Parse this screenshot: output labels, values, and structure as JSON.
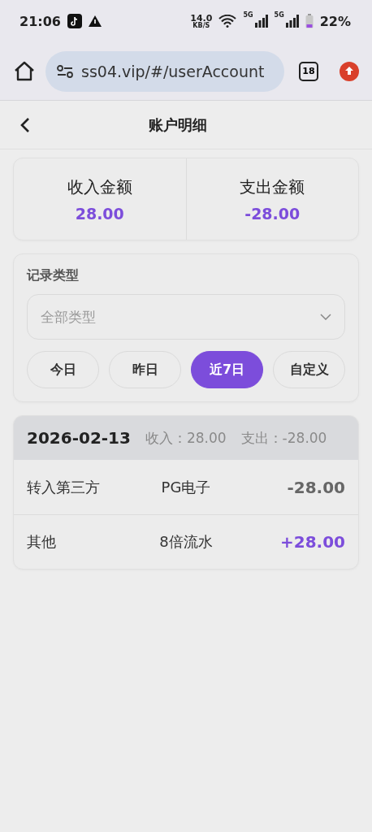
{
  "status_bar": {
    "time": "21:06",
    "net_speed": "14.0",
    "net_unit": "KB/S",
    "sim_labels": [
      "5G",
      "5G"
    ],
    "battery": "22%"
  },
  "browser": {
    "url": "ss04.vip/#/userAccount",
    "tab_count": "18"
  },
  "header": {
    "title": "账户明细"
  },
  "summary": [
    {
      "label": "收入金额",
      "value": "28.00"
    },
    {
      "label": "支出金额",
      "value": "-28.00"
    }
  ],
  "filter": {
    "label": "记录类型",
    "placeholder": "全部类型",
    "ranges": [
      {
        "label": "今日",
        "selected": false
      },
      {
        "label": "昨日",
        "selected": false
      },
      {
        "label": "近7日",
        "selected": true
      },
      {
        "label": "自定义",
        "selected": false
      }
    ]
  },
  "groups": [
    {
      "date": "2026-02-13",
      "income": "收入：28.00",
      "expense": "支出：-28.00",
      "rows": [
        {
          "type": "转入第三方",
          "detail": "PG电子",
          "amount": "-28.00",
          "kind": "expense"
        },
        {
          "type": "其他",
          "detail": "8倍流水",
          "amount": "+28.00",
          "kind": "income"
        }
      ]
    }
  ]
}
